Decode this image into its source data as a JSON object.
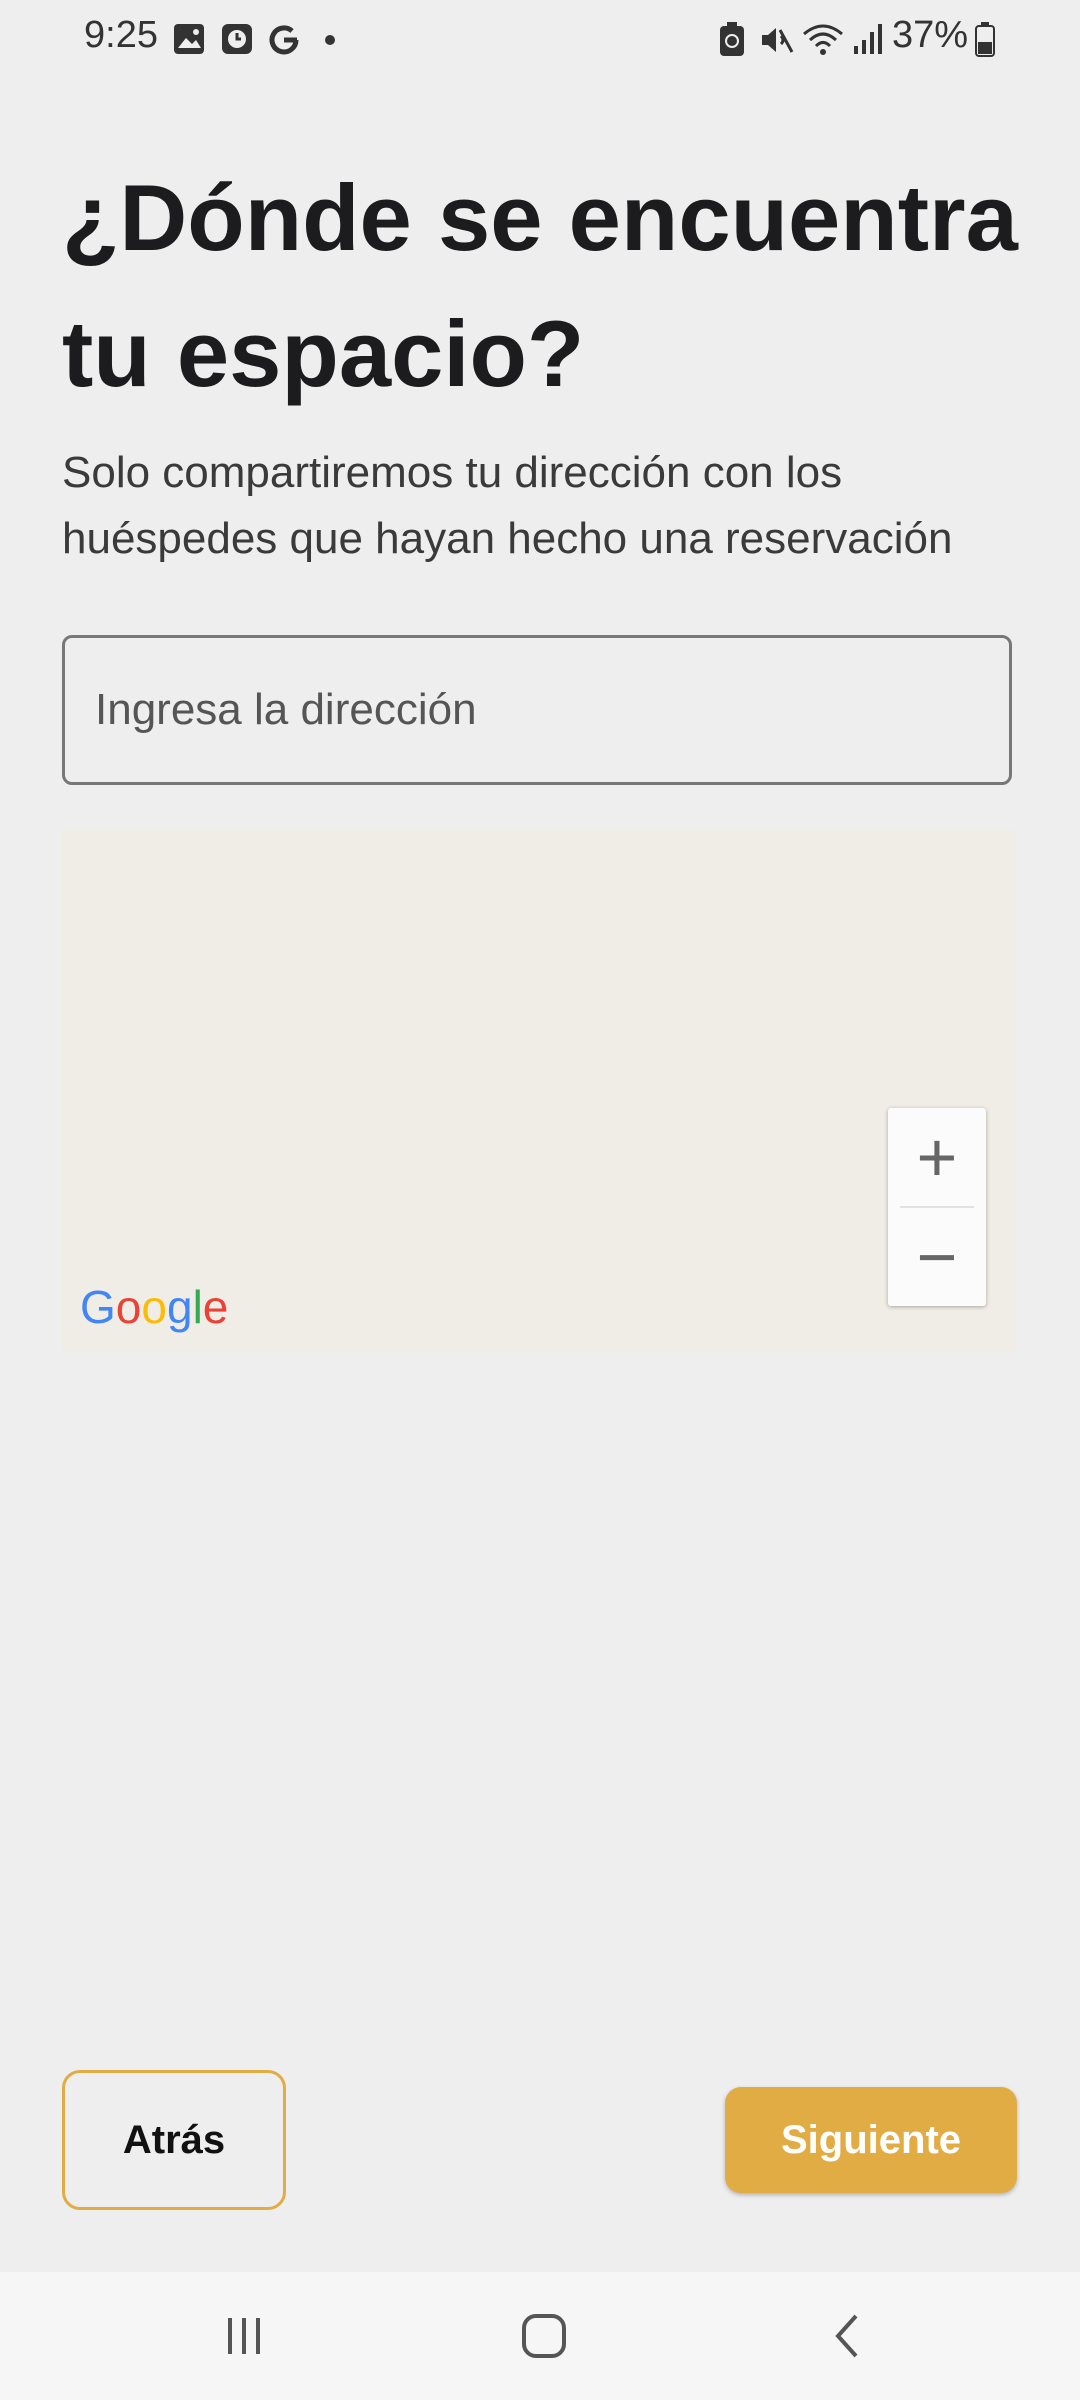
{
  "status_bar": {
    "time": "9:25",
    "battery": "37%",
    "left_icons": [
      "gallery-icon",
      "clock-icon",
      "google-icon",
      "dot-icon"
    ],
    "right_icons": [
      "battery-saver-icon",
      "mute-icon",
      "wifi-icon",
      "signal-icon",
      "battery-icon"
    ]
  },
  "page": {
    "title": "¿Dónde se encuentra tu espacio?",
    "subtitle": "Solo compartiremos tu dirección con los huéspedes que hayan hecho una reservación"
  },
  "address": {
    "placeholder": "Ingresa la dirección",
    "value": ""
  },
  "map": {
    "logo": "Google",
    "zoom_in": "+",
    "zoom_out": "−"
  },
  "actions": {
    "back_label": "Atrás",
    "next_label": "Siguiente"
  },
  "navbar": {
    "items": [
      "recent-apps-icon",
      "home-icon",
      "back-icon"
    ]
  },
  "colors": {
    "accent": "#e2ac44",
    "background": "#eeeeee",
    "map_background": "#f0ede6"
  }
}
